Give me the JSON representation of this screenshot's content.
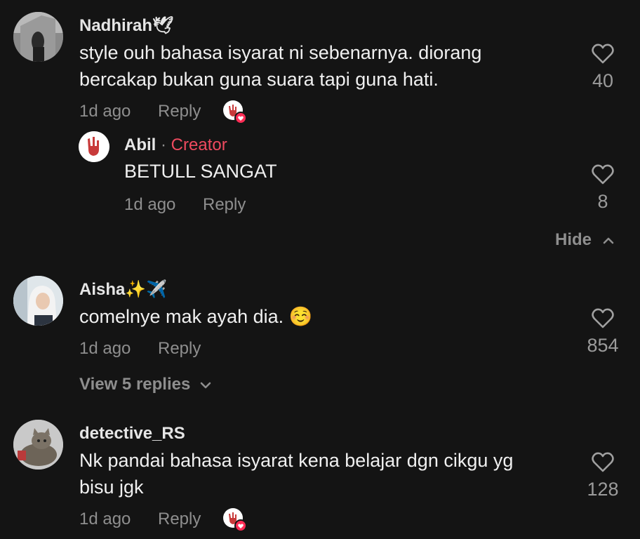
{
  "comments": [
    {
      "username": "Nadhirah",
      "username_emoji": "🕊",
      "text_lines": [
        "style ouh bahasa isyarat ni sebenarnya. diorang",
        "bercakap bukan guna suara tapi guna hati."
      ],
      "time": "1d ago",
      "reply_label": "Reply",
      "likes": "40",
      "creator_liked": true,
      "replies": [
        {
          "username": "Abil",
          "separator": "·",
          "badge": "Creator",
          "text": "BETULL SANGAT",
          "time": "1d ago",
          "reply_label": "Reply",
          "likes": "8"
        }
      ],
      "toggle_label": "Hide"
    },
    {
      "username": "Aisha",
      "username_emoji": "✨✈️",
      "text_lines": [
        "comelnye mak ayah dia. ☺️"
      ],
      "time": "1d ago",
      "reply_label": "Reply",
      "likes": "854",
      "toggle_label": "View 5 replies"
    },
    {
      "username": "detective_RS",
      "text_lines": [
        "Nk pandai bahasa isyarat kena belajar dgn cikgu yg",
        "bisu jgk"
      ],
      "time": "1d ago",
      "reply_label": "Reply",
      "likes": "128",
      "creator_liked": true
    }
  ],
  "colors": {
    "background": "#141414",
    "creator_badge": "#ee4a5f",
    "liked_badge": "#fe2c55",
    "muted": "#8e8e8e"
  },
  "icons": {
    "like": "heart-outline-icon",
    "creator_like": "rock-hand-avatar-with-heart-icon",
    "hide": "chevron-up-icon",
    "view_replies": "chevron-down-icon"
  }
}
